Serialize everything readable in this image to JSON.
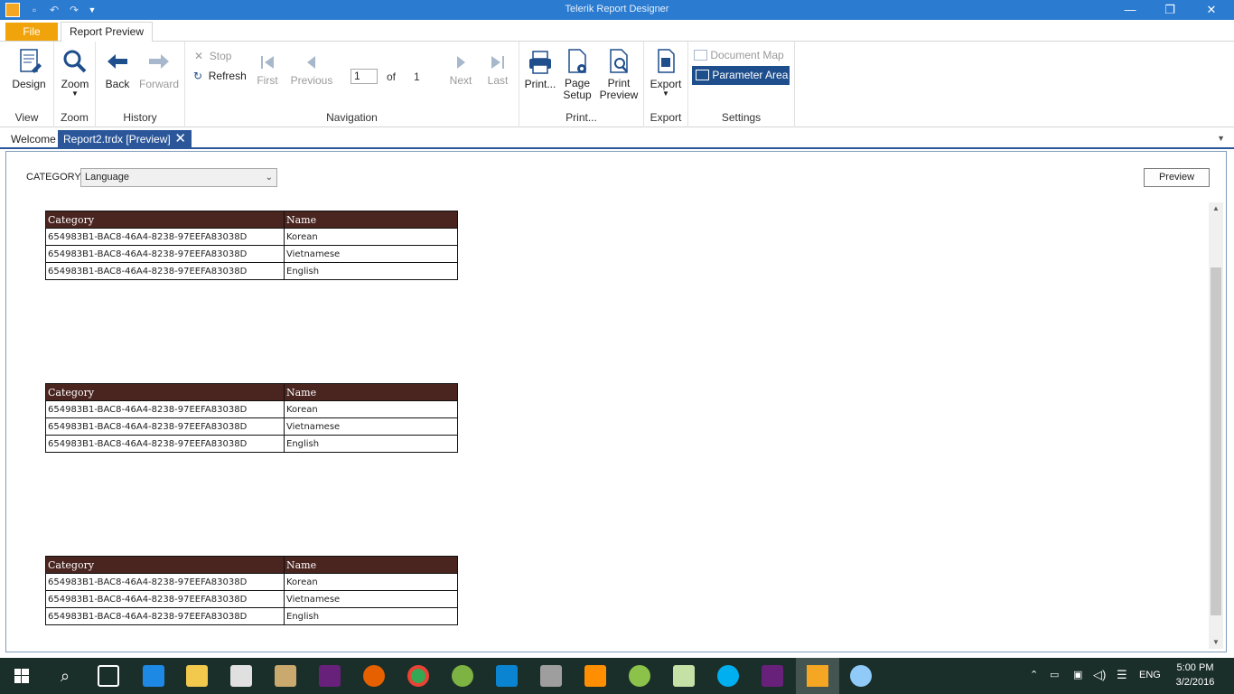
{
  "window": {
    "title": "Telerik Report Designer",
    "minimize_icon": "minimize-icon",
    "restore_icon": "restore-icon",
    "close_icon": "close-icon"
  },
  "ribbon_tabs": {
    "file": "File",
    "report_preview": "Report Preview"
  },
  "ribbon": {
    "view": {
      "label": "View",
      "design": "Design"
    },
    "zoom": {
      "label": "Zoom",
      "zoom": "Zoom"
    },
    "history": {
      "label": "History",
      "back": "Back",
      "forward": "Forward"
    },
    "navigation": {
      "label": "Navigation",
      "stop": "Stop",
      "refresh": "Refresh",
      "first": "First",
      "previous": "Previous",
      "page_value": "1",
      "of": "of",
      "total_pages": "1",
      "next": "Next",
      "last": "Last"
    },
    "print": {
      "label": "Print...",
      "print": "Print...",
      "page_setup_1": "Page",
      "page_setup_2": "Setup",
      "print_preview_1": "Print",
      "print_preview_2": "Preview"
    },
    "export": {
      "label": "Export",
      "export": "Export"
    },
    "settings": {
      "label": "Settings",
      "document_map": "Document Map",
      "parameter_area": "Parameter Area"
    }
  },
  "doc_tabs": {
    "welcome": "Welcome",
    "active": "Report2.trdx [Preview]"
  },
  "parameters": {
    "category_label": "CATEGORY:",
    "category_value": "Language",
    "preview_button": "Preview"
  },
  "report": {
    "headers": [
      "Category",
      "Name"
    ],
    "tables": [
      {
        "rows": [
          [
            "654983B1-BAC8-46A4-8238-97EEFA83038D",
            "Korean"
          ],
          [
            "654983B1-BAC8-46A4-8238-97EEFA83038D",
            "Vietnamese"
          ],
          [
            "654983B1-BAC8-46A4-8238-97EEFA83038D",
            "English"
          ]
        ]
      },
      {
        "rows": [
          [
            "654983B1-BAC8-46A4-8238-97EEFA83038D",
            "Korean"
          ],
          [
            "654983B1-BAC8-46A4-8238-97EEFA83038D",
            "Vietnamese"
          ],
          [
            "654983B1-BAC8-46A4-8238-97EEFA83038D",
            "English"
          ]
        ]
      },
      {
        "rows": [
          [
            "654983B1-BAC8-46A4-8238-97EEFA83038D",
            "Korean"
          ],
          [
            "654983B1-BAC8-46A4-8238-97EEFA83038D",
            "Vietnamese"
          ],
          [
            "654983B1-BAC8-46A4-8238-97EEFA83038D",
            "English"
          ]
        ]
      }
    ]
  },
  "taskbar": {
    "language": "ENG",
    "time": "5:00 PM",
    "date": "3/2/2016"
  },
  "colors": {
    "titlebar": "#2b7bd0",
    "file_tab": "#f0a30a",
    "header_fill": "#4a2520",
    "active_tab": "#2b579a",
    "taskbar": "#1b2f2a"
  }
}
